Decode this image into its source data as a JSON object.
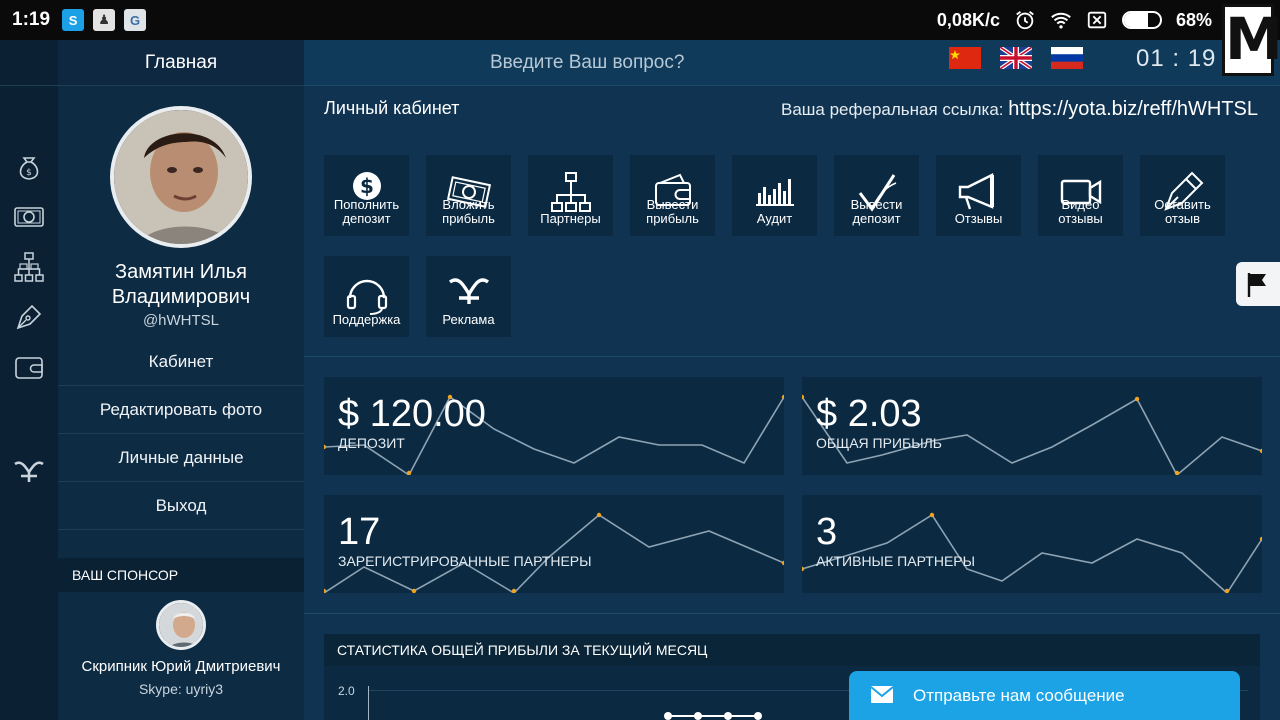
{
  "status_bar": {
    "time": "1:19",
    "network_speed": "0,08K/c",
    "battery_percent": 68,
    "battery_label": "68%"
  },
  "watermark": "M",
  "sidebar": {
    "title": "Главная",
    "profile_name": "Замятин Илья Владимирович",
    "profile_handle": "@hWHTSL",
    "menu": [
      {
        "label": "Кабинет"
      },
      {
        "label": "Редактировать фото"
      },
      {
        "label": "Личные данные"
      },
      {
        "label": "Выход"
      }
    ],
    "sponsor": {
      "heading": "ВАШ СПОНСОР",
      "name": "Скрипник Юрий Дмитриевич",
      "skype": "Skype: uyriy3"
    }
  },
  "header": {
    "search_placeholder": "Введите Ваш вопрос?",
    "clock": "01 : 19"
  },
  "cabinet": {
    "title": "Личный кабинет",
    "ref_label": "Ваша реферальная ссылка:",
    "ref_link": "https://yota.biz/reff/hWHTSL"
  },
  "tiles": [
    {
      "label": "Пополнить депозит",
      "icon": "dollar-icon"
    },
    {
      "label": "Вложить прибыль",
      "icon": "money-icon"
    },
    {
      "label": "Партнеры",
      "icon": "hierarchy-icon"
    },
    {
      "label": "Вывести прибыль",
      "icon": "wallet-icon"
    },
    {
      "label": "Аудит",
      "icon": "bar-chart-icon"
    },
    {
      "label": "Вывести депозит",
      "icon": "check-icon"
    },
    {
      "label": "Отзывы",
      "icon": "megaphone-icon"
    },
    {
      "label": "Видео отзывы",
      "icon": "video-icon"
    },
    {
      "label": "Оставить отзыв",
      "icon": "pen-icon"
    },
    {
      "label": "Поддержка",
      "icon": "headset-icon"
    },
    {
      "label": "Реклама",
      "icon": "logo-icon"
    }
  ],
  "stats": [
    {
      "value": "$ 120.00",
      "label": "ДЕПОЗИТ"
    },
    {
      "value": "$ 2.03",
      "label": "ОБЩАЯ ПРИБЫЛЬ"
    },
    {
      "value": "17",
      "label": "ЗАРЕГИСТРИРОВАННЫЕ ПАРТНЕРЫ"
    },
    {
      "value": "3",
      "label": "АКТИВНЫЕ ПАРТНЕРЫ"
    }
  ],
  "profit_chart": {
    "title": "СТАТИСТИКА ОБЩЕЙ ПРИБЫЛИ ЗА ТЕКУЩИЙ МЕСЯЦ",
    "y_tick_top": "2.0"
  },
  "message_button": {
    "label": "Отправьте нам сообщение"
  },
  "colors": {
    "accent": "#1ba3e6",
    "sparkline": "#8ea3b3",
    "spark_point": "#f0a31c"
  }
}
